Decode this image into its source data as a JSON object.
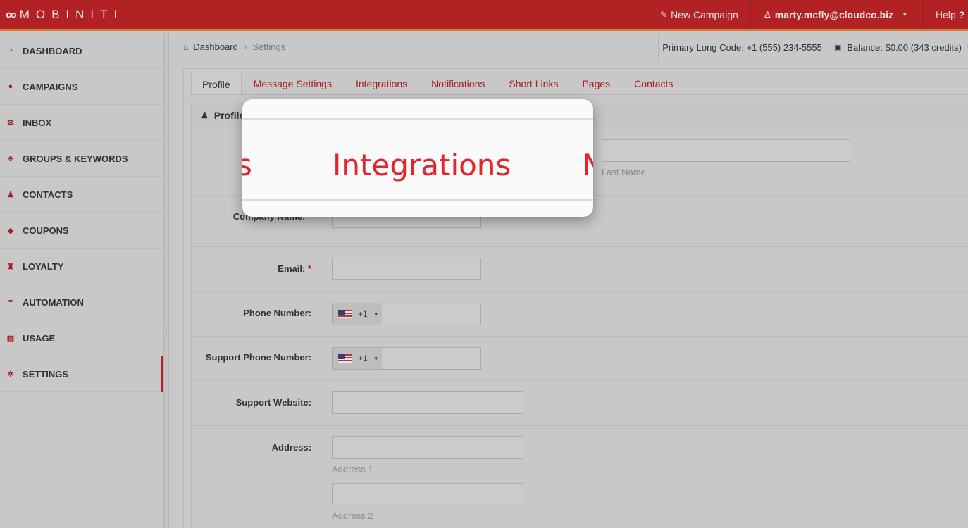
{
  "header": {
    "logo_text": "MOBINITI",
    "new_campaign": "New Campaign",
    "user_email": "marty.mcfly@cloudco.biz",
    "help": "Help"
  },
  "sidebar": {
    "items": [
      {
        "label": "DASHBOARD",
        "icon": "dashboard-icon"
      },
      {
        "label": "CAMPAIGNS",
        "icon": "comment-icon"
      },
      {
        "label": "INBOX",
        "icon": "envelope-icon"
      },
      {
        "label": "GROUPS & KEYWORDS",
        "icon": "users-icon"
      },
      {
        "label": "CONTACTS",
        "icon": "user-icon"
      },
      {
        "label": "COUPONS",
        "icon": "tag-icon"
      },
      {
        "label": "LOYALTY",
        "icon": "trophy-icon"
      },
      {
        "label": "AUTOMATION",
        "icon": "tasks-icon"
      },
      {
        "label": "USAGE",
        "icon": "bar-chart-icon"
      },
      {
        "label": "SETTINGS",
        "icon": "cog-icon",
        "active": true
      }
    ]
  },
  "breadcrumb": {
    "home": "Dashboard",
    "current": "Settings"
  },
  "status": {
    "long_code": "Primary Long Code: +1 (555) 234-5555",
    "balance": "Balance: $0.00 (343 credits)"
  },
  "tabs": [
    "Profile",
    "Message Settings",
    "Integrations",
    "Notifications",
    "Short Links",
    "Pages",
    "Contacts"
  ],
  "profile": {
    "title": "Profile",
    "last_name_hint": "Last Name",
    "company_label": "Company Name:",
    "email_label": "Email:",
    "phone_label": "Phone Number:",
    "support_phone_label": "Support Phone Number:",
    "support_website_label": "Support Website:",
    "address_label": "Address:",
    "address1_hint": "Address 1",
    "address2_hint": "Address 2",
    "required_mark": "*",
    "country_code": "+1"
  },
  "zoom": {
    "left_fragment": "s",
    "center": "Integrations",
    "right_fragment": "N"
  },
  "colors": {
    "brand_red": "#b22225",
    "link_red": "#a51e22",
    "zoom_red": "#e3242b"
  }
}
